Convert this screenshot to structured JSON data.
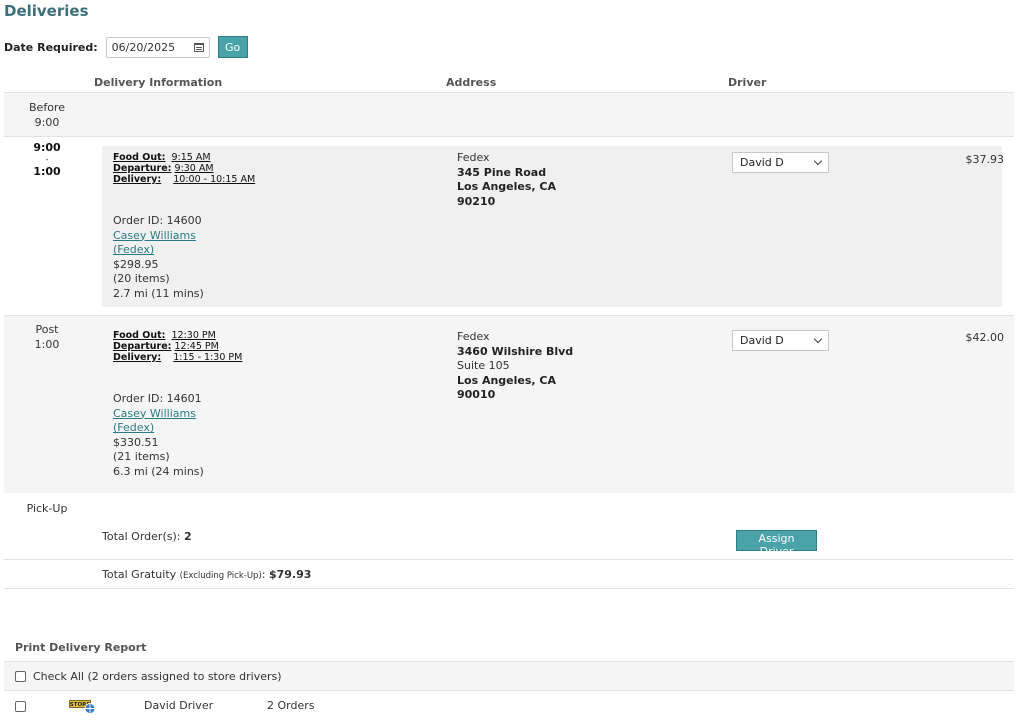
{
  "page": {
    "title": "Deliveries"
  },
  "filter": {
    "date_label": "Date Required:",
    "date_value": "06/20/2025",
    "go_label": "Go"
  },
  "columns": {
    "info": "Delivery Information",
    "address": "Address",
    "driver": "Driver"
  },
  "slots": {
    "before": {
      "line1": "Before",
      "line2": "9:00"
    },
    "window": {
      "start": "9:00",
      "sep": "-",
      "end": "1:00"
    },
    "post": {
      "line1": "Post",
      "line2": "1:00"
    },
    "pickup": {
      "label": "Pick-Up"
    }
  },
  "orders": [
    {
      "food_out_label": "Food Out:",
      "food_out": "9:15 AM",
      "departure_label": "Departure:",
      "departure": "9:30 AM",
      "delivery_label": "Delivery:",
      "delivery": "10:00 - 10:15 AM",
      "order_id": "Order ID: 14600",
      "customer": "Casey Williams",
      "company": "(Fedex)",
      "amount": "$298.95",
      "items": "(20 items)",
      "distance": "2.7 mi (11 mins)",
      "address": {
        "company": "Fedex",
        "street": "345 Pine Road",
        "city": "Los Angeles, CA",
        "zip": "90210"
      },
      "driver": "David D",
      "gratuity": "$37.93"
    },
    {
      "food_out_label": "Food Out:",
      "food_out": "12:30 PM",
      "departure_label": "Departure:",
      "departure": "12:45 PM",
      "delivery_label": "Delivery:",
      "delivery": "1:15 - 1:30 PM",
      "order_id": "Order ID: 14601",
      "customer": "Casey Williams",
      "company": "(Fedex)",
      "amount": "$330.51",
      "items": "(21 items)",
      "distance": "6.3 mi (24 mins)",
      "address": {
        "company": "Fedex",
        "street": "3460 Wilshire Blvd",
        "suite": "Suite 105",
        "city": "Los Angeles, CA",
        "zip": "90010"
      },
      "driver": "David D",
      "gratuity": "$42.00"
    }
  ],
  "totals": {
    "orders_label": "Total Order(s): ",
    "orders_value": "2",
    "gratuity_label": "Total Gratuity ",
    "gratuity_note": "(Excluding Pick-Up)",
    "gratuity_colon": ": ",
    "gratuity_value": "$79.93"
  },
  "assign_label": "Assign Driver",
  "report": {
    "title": "Print Delivery Report",
    "check_all": "Check All (2 orders assigned to store drivers)",
    "drivers": [
      {
        "name": "David Driver",
        "orders": "2 Orders",
        "icon_text": "STORE"
      }
    ]
  },
  "colors": {
    "accent": "#4aa3a8",
    "title": "#3d6f7a",
    "link": "#2a7c84"
  }
}
